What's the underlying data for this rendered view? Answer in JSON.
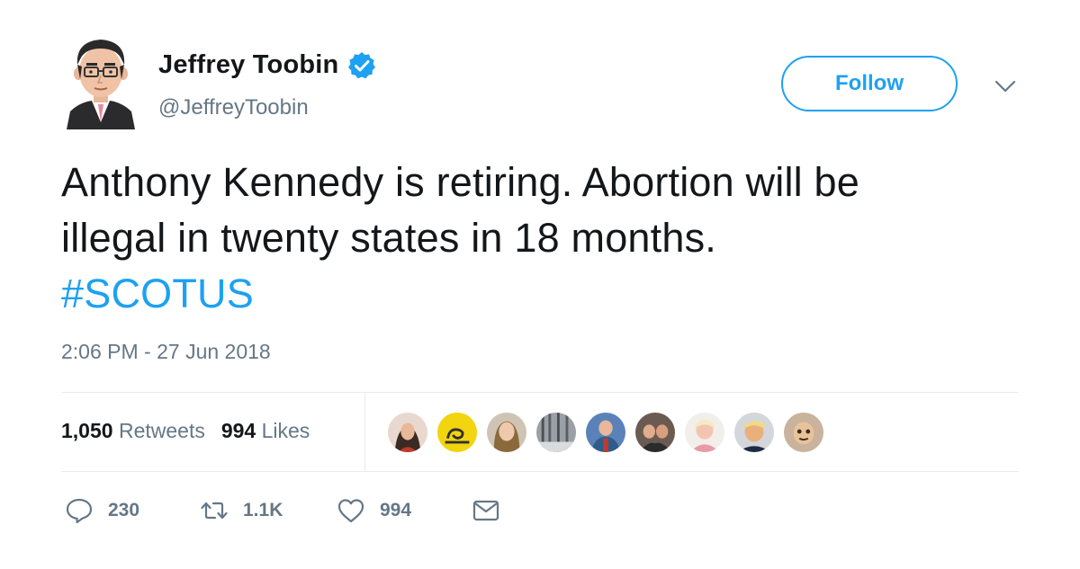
{
  "author": {
    "display_name": "Jeffrey Toobin",
    "handle": "@JeffreyToobin",
    "verified": true,
    "avatar_icon": "cartoon-portrait-avatar"
  },
  "follow_label": "Follow",
  "tweet": {
    "line1": "Anthony Kennedy is retiring. Abortion will be",
    "line2": "illegal in twenty states in 18 months.",
    "hashtag": "#SCOTUS"
  },
  "timestamp": "2:06 PM - 27 Jun 2018",
  "stats": {
    "retweets_count": "1,050",
    "retweets_label": "Retweets",
    "likes_count": "994",
    "likes_label": "Likes"
  },
  "likers": [
    {
      "icon": "liker-avatar-1"
    },
    {
      "icon": "liker-avatar-gadsden-flag"
    },
    {
      "icon": "liker-avatar-3"
    },
    {
      "icon": "liker-avatar-4"
    },
    {
      "icon": "liker-avatar-5"
    },
    {
      "icon": "liker-avatar-6"
    },
    {
      "icon": "liker-avatar-7"
    },
    {
      "icon": "liker-avatar-8"
    },
    {
      "icon": "liker-avatar-9"
    }
  ],
  "actions": {
    "reply_count": "230",
    "retweet_count": "1.1K",
    "like_count": "994"
  },
  "colors": {
    "accent": "#1da1f2",
    "text": "#14171a",
    "secondary": "#657786",
    "divider": "#e6ecf0"
  }
}
